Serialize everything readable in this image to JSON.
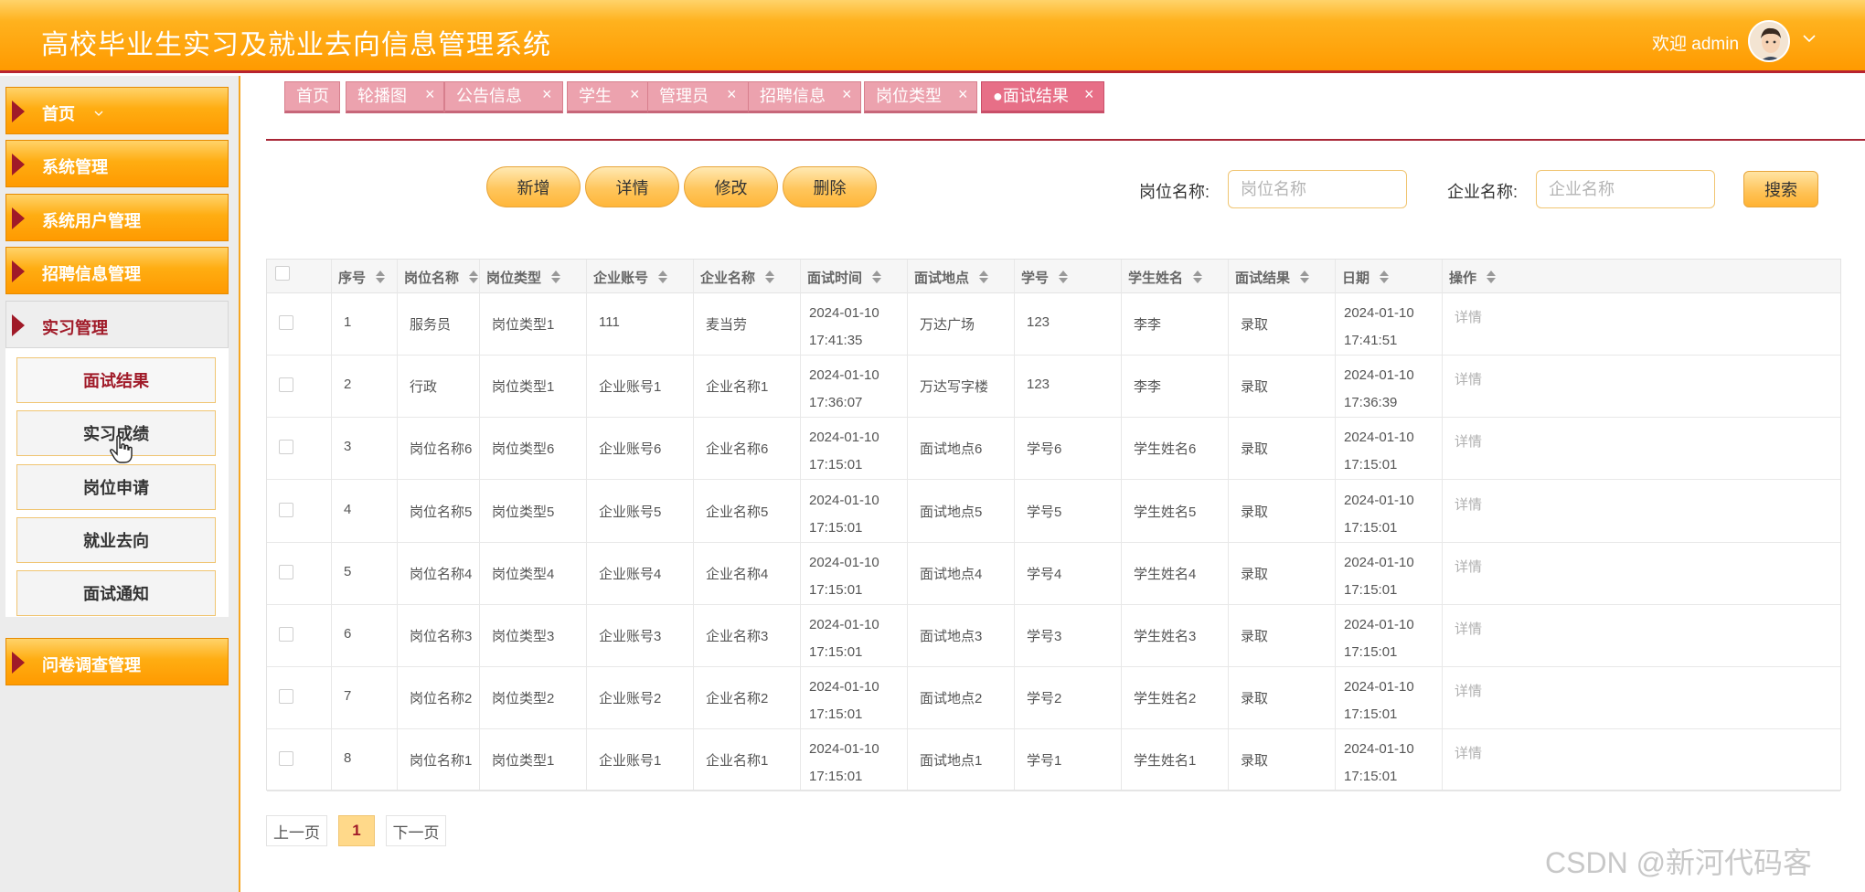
{
  "header": {
    "title": "高校毕业生实习及就业去向信息管理系统",
    "welcome": "欢迎 admin",
    "avatar_icon": "user-avatar-icon",
    "dropdown_icon": "chevron-down-icon"
  },
  "sidebar": {
    "items": [
      {
        "label": "首页"
      },
      {
        "label": "系统管理"
      },
      {
        "label": "系统用户管理"
      },
      {
        "label": "招聘信息管理"
      },
      {
        "label": "实习管理"
      },
      {
        "label": "问卷调查管理"
      }
    ],
    "submenu": [
      {
        "label": "面试结果"
      },
      {
        "label": "实习成绩"
      },
      {
        "label": "岗位申请"
      },
      {
        "label": "就业去向"
      },
      {
        "label": "面试通知"
      }
    ]
  },
  "tabs": [
    {
      "label": "首页"
    },
    {
      "label": "轮播图"
    },
    {
      "label": "公告信息"
    },
    {
      "label": "学生"
    },
    {
      "label": "管理员"
    },
    {
      "label": "招聘信息"
    },
    {
      "label": "岗位类型"
    },
    {
      "label": "●面试结果"
    }
  ],
  "toolbar": {
    "add": "新增",
    "detail": "详情",
    "edit": "修改",
    "delete": "删除",
    "job_label": "岗位名称:",
    "job_placeholder": "岗位名称",
    "company_label": "企业名称:",
    "company_placeholder": "企业名称",
    "search": "搜索"
  },
  "table": {
    "headers": [
      "序号",
      "岗位名称",
      "岗位类型",
      "企业账号",
      "企业名称",
      "面试时间",
      "面试地点",
      "学号",
      "学生姓名",
      "面试结果",
      "日期",
      "操作"
    ],
    "rows": [
      {
        "no": "1",
        "job": "服务员",
        "type": "岗位类型1",
        "account": "111",
        "company": "麦当劳",
        "time_d": "2024-01-10",
        "time_t": "17:41:35",
        "place": "万达广场",
        "sid": "123",
        "name": "李李",
        "result": "录取",
        "date_d": "2024-01-10",
        "date_t": "17:41:51",
        "op": "详情"
      },
      {
        "no": "2",
        "job": "行政",
        "type": "岗位类型1",
        "account": "企业账号1",
        "company": "企业名称1",
        "time_d": "2024-01-10",
        "time_t": "17:36:07",
        "place": "万达写字楼",
        "sid": "123",
        "name": "李李",
        "result": "录取",
        "date_d": "2024-01-10",
        "date_t": "17:36:39",
        "op": "详情"
      },
      {
        "no": "3",
        "job": "岗位名称6",
        "type": "岗位类型6",
        "account": "企业账号6",
        "company": "企业名称6",
        "time_d": "2024-01-10",
        "time_t": "17:15:01",
        "place": "面试地点6",
        "sid": "学号6",
        "name": "学生姓名6",
        "result": "录取",
        "date_d": "2024-01-10",
        "date_t": "17:15:01",
        "op": "详情"
      },
      {
        "no": "4",
        "job": "岗位名称5",
        "type": "岗位类型5",
        "account": "企业账号5",
        "company": "企业名称5",
        "time_d": "2024-01-10",
        "time_t": "17:15:01",
        "place": "面试地点5",
        "sid": "学号5",
        "name": "学生姓名5",
        "result": "录取",
        "date_d": "2024-01-10",
        "date_t": "17:15:01",
        "op": "详情"
      },
      {
        "no": "5",
        "job": "岗位名称4",
        "type": "岗位类型4",
        "account": "企业账号4",
        "company": "企业名称4",
        "time_d": "2024-01-10",
        "time_t": "17:15:01",
        "place": "面试地点4",
        "sid": "学号4",
        "name": "学生姓名4",
        "result": "录取",
        "date_d": "2024-01-10",
        "date_t": "17:15:01",
        "op": "详情"
      },
      {
        "no": "6",
        "job": "岗位名称3",
        "type": "岗位类型3",
        "account": "企业账号3",
        "company": "企业名称3",
        "time_d": "2024-01-10",
        "time_t": "17:15:01",
        "place": "面试地点3",
        "sid": "学号3",
        "name": "学生姓名3",
        "result": "录取",
        "date_d": "2024-01-10",
        "date_t": "17:15:01",
        "op": "详情"
      },
      {
        "no": "7",
        "job": "岗位名称2",
        "type": "岗位类型2",
        "account": "企业账号2",
        "company": "企业名称2",
        "time_d": "2024-01-10",
        "time_t": "17:15:01",
        "place": "面试地点2",
        "sid": "学号2",
        "name": "学生姓名2",
        "result": "录取",
        "date_d": "2024-01-10",
        "date_t": "17:15:01",
        "op": "详情"
      },
      {
        "no": "8",
        "job": "岗位名称1",
        "type": "岗位类型1",
        "account": "企业账号1",
        "company": "企业名称1",
        "time_d": "2024-01-10",
        "time_t": "17:15:01",
        "place": "面试地点1",
        "sid": "学号1",
        "name": "学生姓名1",
        "result": "录取",
        "date_d": "2024-01-10",
        "date_t": "17:15:01",
        "op": "详情"
      }
    ]
  },
  "pagination": {
    "prev": "上一页",
    "current": "1",
    "next": "下一页"
  },
  "watermark": "CSDN @新河代码客"
}
